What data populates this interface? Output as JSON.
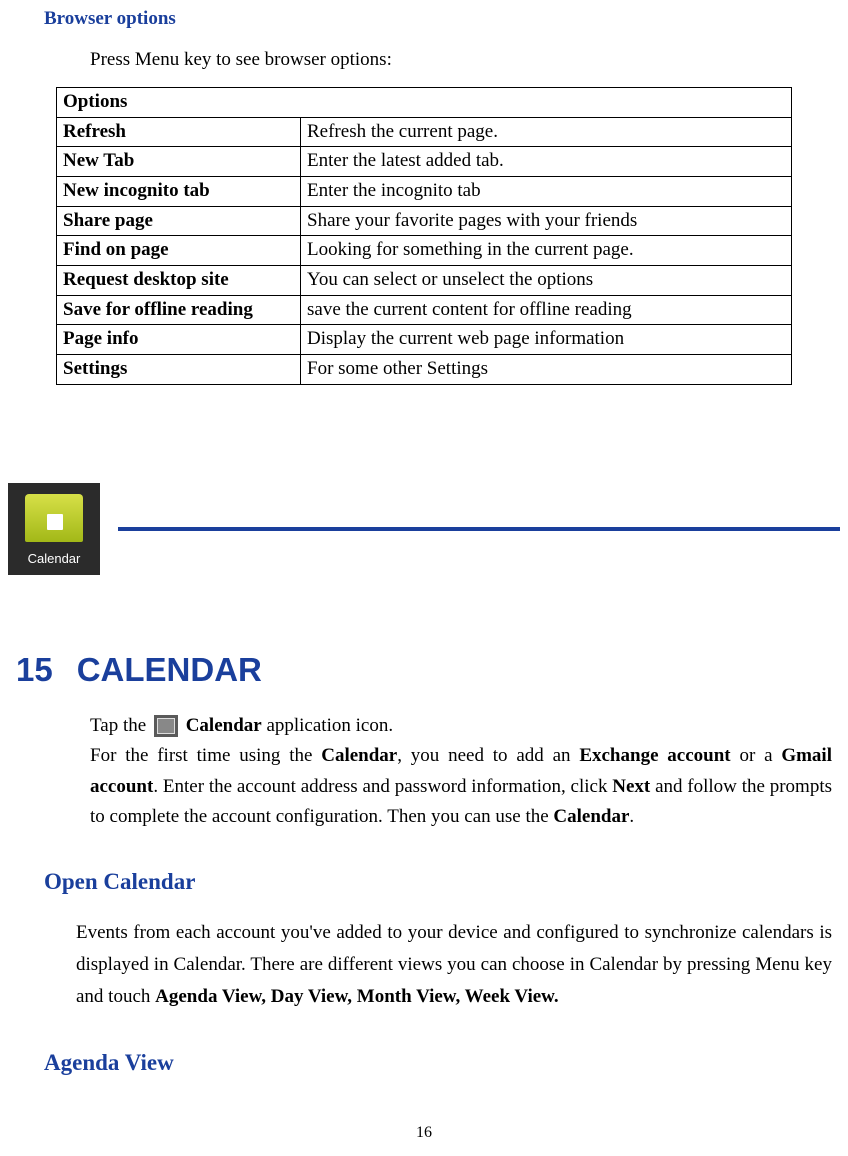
{
  "section_title": {
    "browser": "Browser",
    "options": " options"
  },
  "intro": "Press Menu key to see browser options:",
  "table": {
    "header": "Options",
    "rows": [
      {
        "name": "Refresh",
        "desc": "Refresh the current page."
      },
      {
        "name": "New Tab",
        "desc": "Enter the latest added tab."
      },
      {
        "name": "New incognito tab",
        "desc": "Enter the incognito tab"
      },
      {
        "name": "Share page",
        "desc": "Share your favorite pages with your friends"
      },
      {
        "name": "Find on page",
        "desc": "Looking for something in the current page."
      },
      {
        "name": "Request desktop site",
        "desc": "You can select or unselect the options"
      },
      {
        "name": "Save for offline reading",
        "desc": "save the current content for offline reading"
      },
      {
        "name": "Page info",
        "desc": "Display the current web page information"
      },
      {
        "name": "Settings",
        "desc": "For some other Settings"
      }
    ]
  },
  "app_icon_label": "Calendar",
  "chapter": {
    "number": "15",
    "title": "CALENDAR"
  },
  "calendar_intro": {
    "pre": "Tap the ",
    "bold1": " Calendar",
    "mid1": " application icon.",
    "line2_a": "For the first time using the ",
    "line2_b": "Calendar",
    "line2_c": ", you need to add an ",
    "line2_d": "Exchange account",
    "line2_e": " or a ",
    "line2_f": "Gmail account",
    "line2_g": ". Enter the account address and password information, click ",
    "line2_h": "Next",
    "line2_i": " and follow the prompts to complete the account configuration. Then you can use the ",
    "line2_j": "Calendar",
    "line2_k": "."
  },
  "open_calendar_heading": "Open Calendar",
  "open_calendar_body": {
    "a": "Events from each account you've added to your device and configured to synchronize calendars is displayed in Calendar. There are different views you can choose in Calendar by pressing Menu key and touch ",
    "b": "Agenda View, Day View, Month View, Week View."
  },
  "agenda_view_heading": "Agenda View",
  "page_number": "16"
}
